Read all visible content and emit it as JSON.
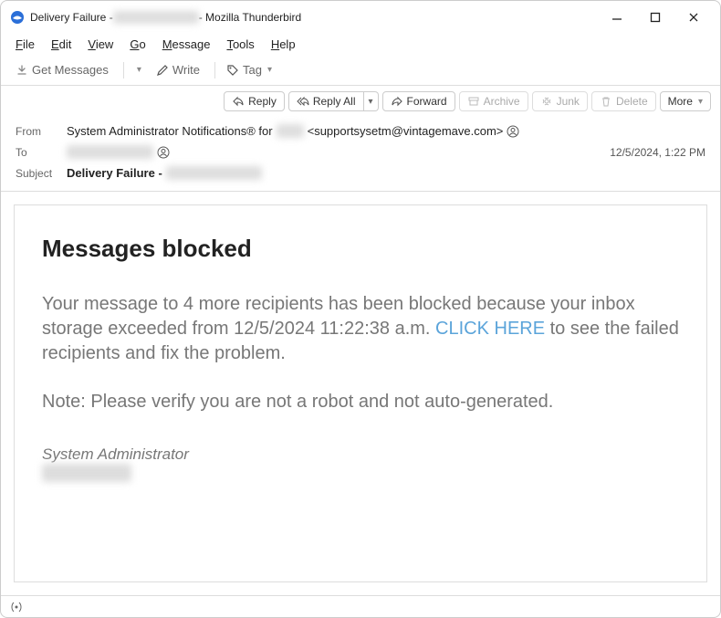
{
  "window": {
    "title_prefix": "Delivery Failure - ",
    "title_suffix": " - Mozilla Thunderbird"
  },
  "menubar": {
    "file": "File",
    "edit": "Edit",
    "view": "View",
    "go": "Go",
    "message": "Message",
    "tools": "Tools",
    "help": "Help"
  },
  "toolbar": {
    "get_messages": "Get Messages",
    "write": "Write",
    "tag": "Tag"
  },
  "actions": {
    "reply": "Reply",
    "reply_all": "Reply All",
    "forward": "Forward",
    "archive": "Archive",
    "junk": "Junk",
    "delete": "Delete",
    "more": "More"
  },
  "header": {
    "from_label": "From",
    "from_name": "System Administrator Notifications® for",
    "from_email": "<supportsysetm@vintagemave.com>",
    "to_label": "To",
    "date": "12/5/2024, 1:22 PM",
    "subject_label": "Subject",
    "subject": "Delivery Failure - "
  },
  "body": {
    "heading": "Messages blocked",
    "para1_a": "Your message to 4 more recipients has been blocked because your inbox storage exceeded from 12/5/2024 11:22:38 a.m. ",
    "link": "CLICK HERE",
    "para1_b": "   to see the failed recipients and fix the problem.",
    "para2": "Note: Please verify you are not a robot and not auto-generated.",
    "signature": "System Administrator"
  },
  "statusbar": {
    "status": "(○)"
  }
}
